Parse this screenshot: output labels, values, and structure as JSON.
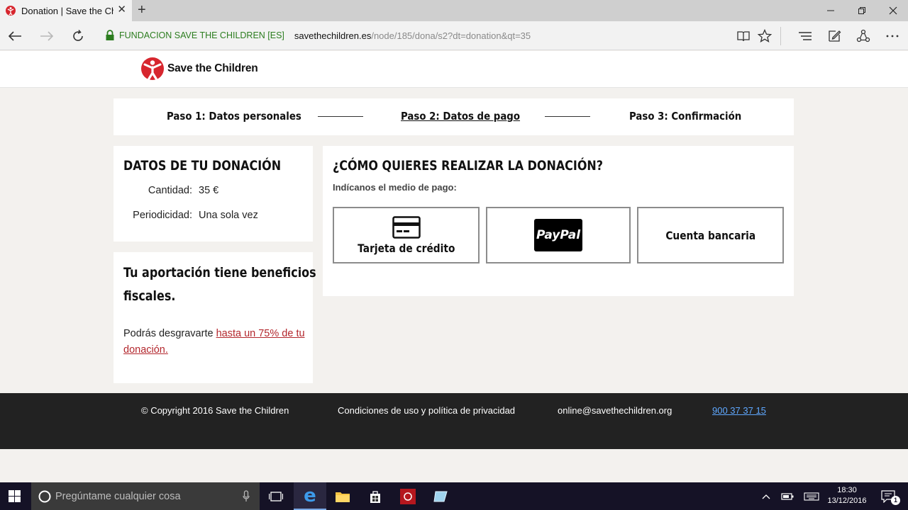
{
  "browser": {
    "tab_title": "Donation | Save the Chi",
    "new_tab_label": "+",
    "cert_name": "FUNDACION SAVE THE CHILDREN [ES]",
    "url_domain": "savethechildren.es",
    "url_path": "/node/185/dona/s2?dt=donation&qt=35"
  },
  "header": {
    "logo_text": "Save the Children"
  },
  "steps": [
    {
      "label": "Paso 1: Datos personales",
      "active": false
    },
    {
      "label": "Paso 2: Datos de pago",
      "active": true
    },
    {
      "label": "Paso 3: Confirmación",
      "active": false
    }
  ],
  "summary": {
    "title": "DATOS DE TU DONACIÓN",
    "rows": [
      {
        "label": "Cantidad:",
        "value": "35 €"
      },
      {
        "label": "Periodicidad:",
        "value": "Una sola vez"
      }
    ]
  },
  "benefits": {
    "title_line1": "Tu aportación tiene beneficios",
    "title_line2": "fiscales.",
    "text": "Podrás desgravarte ",
    "link": "hasta un 75% de tu donación."
  },
  "payment": {
    "title": "¿CÓMO QUIERES REALIZAR LA DONACIÓN?",
    "subtitle": "Indícanos el medio de pago:",
    "options": [
      {
        "label": "Tarjeta de crédito",
        "icon": "credit-card-icon"
      },
      {
        "label": "PayPal",
        "icon": "paypal-logo"
      },
      {
        "label": "Cuenta bancaria",
        "icon": ""
      }
    ]
  },
  "footer": {
    "copyright": "© Copyright 2016 Save the Children",
    "terms": "Condiciones de uso y política de privacidad",
    "email": "online@savethechildren.org",
    "phone": "900 37 37 15"
  },
  "taskbar": {
    "search_placeholder": "Pregúntame cualquier cosa",
    "time": "18:30",
    "date": "13/12/2016",
    "notification_count": "1"
  },
  "colors": {
    "accent_red": "#d7262e",
    "link_red": "#b3272d",
    "cert_green": "#2c7d1f",
    "footer_bg": "#222222",
    "page_bg": "#f3f1ee"
  }
}
